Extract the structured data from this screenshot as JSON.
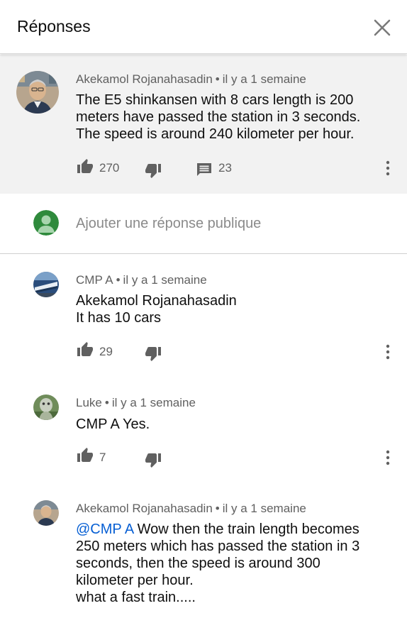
{
  "header": {
    "title": "Réponses",
    "close_icon": "close-icon"
  },
  "parent_comment": {
    "author": "Akekamol Rojanahasadin",
    "time": "il y a 1 semaine",
    "text": "The E5 shinkansen with 8 cars length is 200 meters have passed the station in 3 seconds. The speed is around 240 kilometer per hour.",
    "likes": "270",
    "replies": "23"
  },
  "reply_box": {
    "placeholder": "Ajouter une réponse publique"
  },
  "replies": [
    {
      "author": "CMP A",
      "time": "il y a 1 semaine",
      "text_line1": "Akekamol Rojanahasadin",
      "text_line2": "It has 10 cars",
      "likes": "29"
    },
    {
      "author": "Luke",
      "time": "il y a 1 semaine",
      "text": "CMP A Yes.",
      "likes": "7"
    },
    {
      "author": "Akekamol Rojanahasadin",
      "time": "il y a 1 semaine",
      "mention": "@CMP A",
      "text": " Wow then the train length becomes 250 meters which has passed the station in 3 seconds, then the speed is around 300 kilometer per hour.",
      "text_last": "what a fast train....."
    }
  ],
  "colors": {
    "mention": "#065fd4",
    "meta": "#606060",
    "parent_bg": "#f2f2f2"
  }
}
